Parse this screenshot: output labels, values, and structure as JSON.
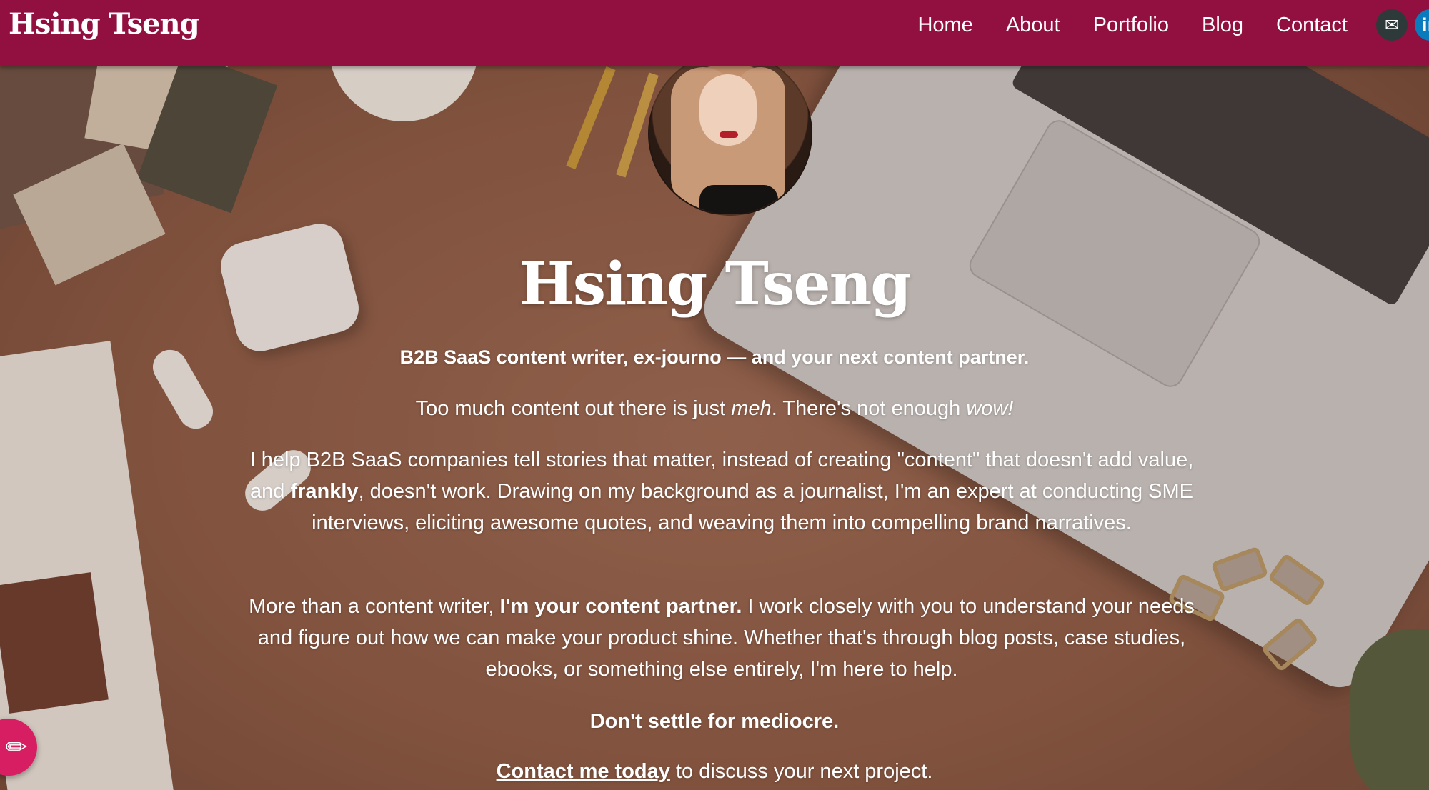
{
  "site": {
    "logo": "Hsing Tseng"
  },
  "nav": {
    "items": [
      "Home",
      "About",
      "Portfolio",
      "Blog",
      "Contact"
    ],
    "social": [
      {
        "icon": "email-icon",
        "glyph": "✉"
      },
      {
        "icon": "linkedin-icon",
        "glyph": "in"
      }
    ]
  },
  "hero": {
    "title": "Hsing Tseng",
    "tagline": "B2B SaaS content writer, ex-journo — and your next content partner.",
    "intro": {
      "a": "Too much content out there is just ",
      "b": "meh",
      "c": ". There's not enough ",
      "d": "wow!"
    },
    "body1": {
      "a": "I help B2B SaaS companies tell stories that matter, instead of creating \"content\" that doesn't add value, and ",
      "b": "frankly",
      "c": ", doesn't work. Drawing on my background as a journalist, I'm an expert at conducting SME interviews, eliciting awesome quotes, and weaving them into compelling brand narratives."
    },
    "body2": {
      "a": "More than a content writer, ",
      "b": "I'm your content partner.",
      "c": " I work closely with you to understand your needs and figure out how we can make your product shine. Whether that's through blog posts, case studies, ebooks, or something else entirely, I'm here to help."
    },
    "cta_strong": "Don't settle for mediocre.",
    "cta": {
      "link": "Contact me today",
      "rest": " to discuss your next project."
    }
  },
  "colors": {
    "navbar": "#911040",
    "fab": "#d81e63"
  }
}
